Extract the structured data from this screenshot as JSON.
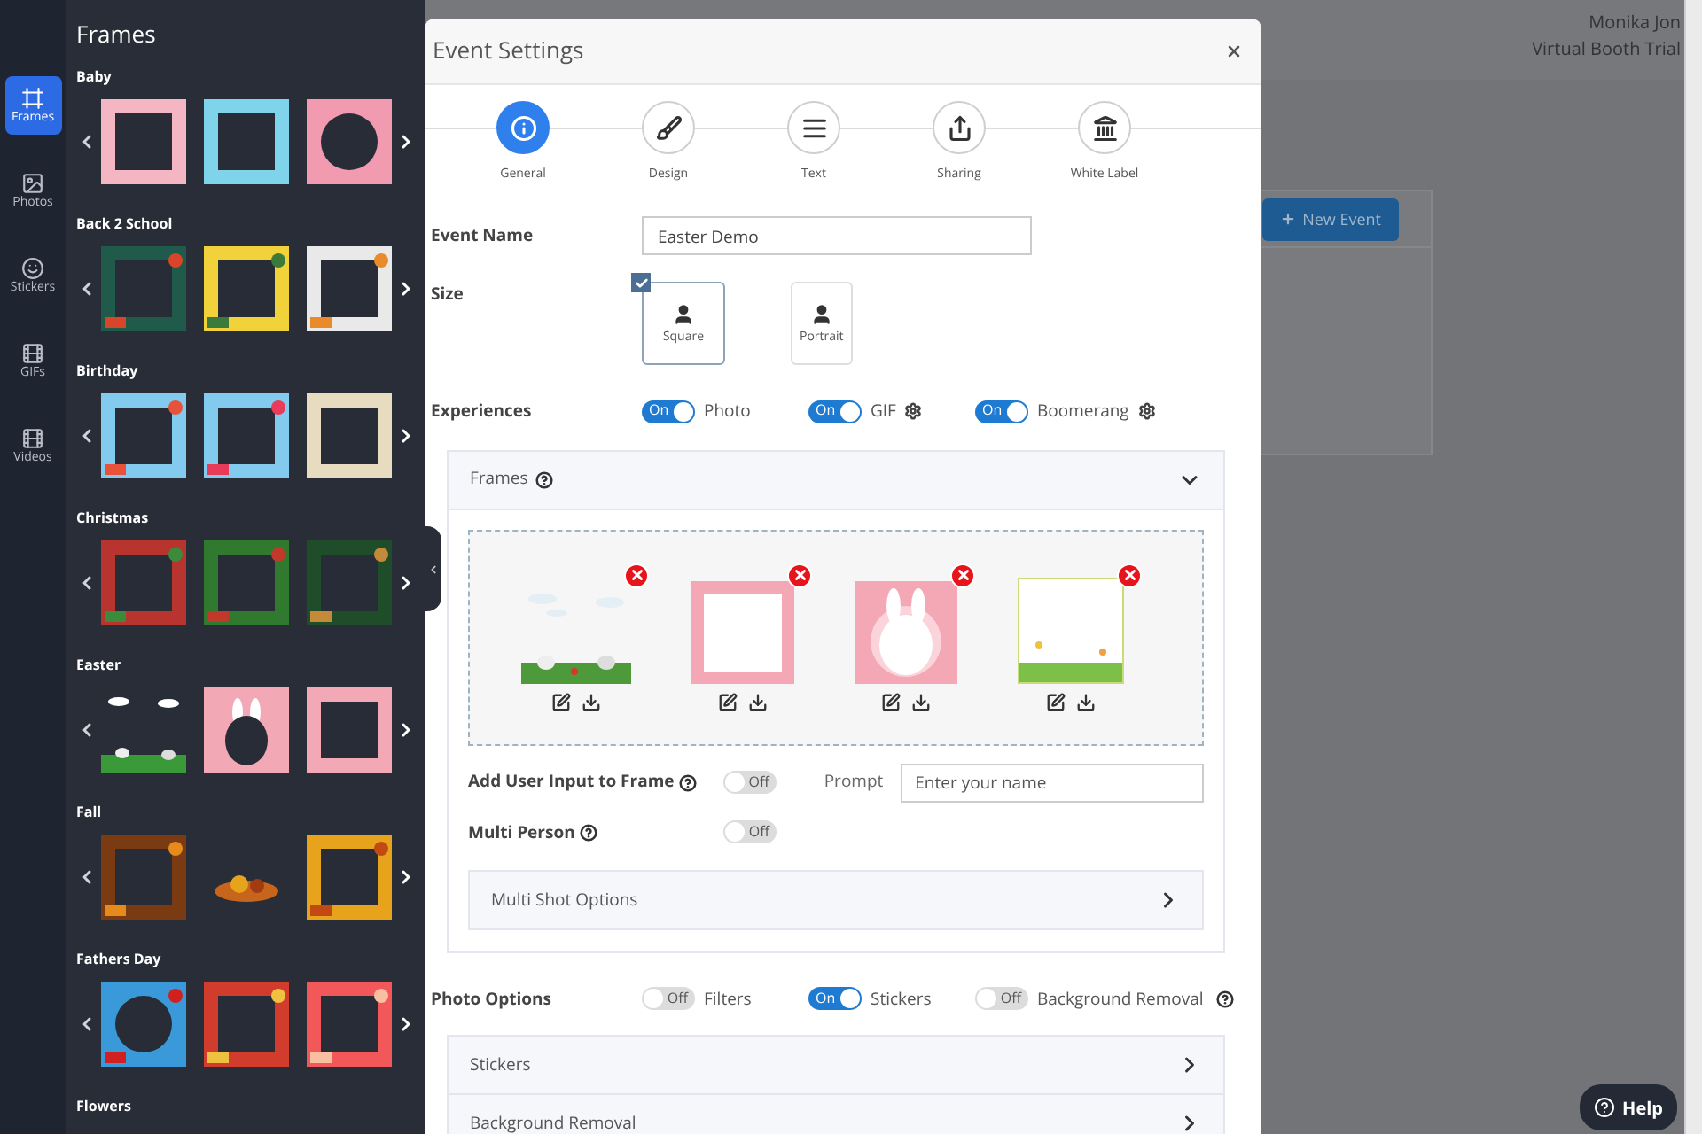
{
  "sidebar": {
    "items": [
      {
        "label": "Frames",
        "selected": true
      },
      {
        "label": "Photos",
        "selected": false
      },
      {
        "label": "Stickers",
        "selected": false
      },
      {
        "label": "GIFs",
        "selected": false
      },
      {
        "label": "Videos",
        "selected": false
      }
    ]
  },
  "frames_panel": {
    "title": "Frames",
    "categories": [
      {
        "name": "Baby"
      },
      {
        "name": "Back 2 School"
      },
      {
        "name": "Birthday"
      },
      {
        "name": "Christmas"
      },
      {
        "name": "Easter"
      },
      {
        "name": "Fall"
      },
      {
        "name": "Fathers Day"
      },
      {
        "name": "Flowers"
      }
    ]
  },
  "page": {
    "user_name": "Monika Jon",
    "account": "Virtual Booth Trial",
    "new_event_button": "New Event"
  },
  "modal": {
    "title": "Event Settings",
    "steps": [
      {
        "label": "General",
        "selected": true
      },
      {
        "label": "Design",
        "selected": false
      },
      {
        "label": "Text",
        "selected": false
      },
      {
        "label": "Sharing",
        "selected": false
      },
      {
        "label": "White Label",
        "selected": false
      }
    ],
    "event_name": {
      "label": "Event Name",
      "value": "Easter Demo"
    },
    "size": {
      "label": "Size",
      "options": [
        {
          "label": "Square",
          "selected": true
        },
        {
          "label": "Portrait",
          "selected": false
        }
      ]
    },
    "experiences": {
      "label": "Experiences",
      "items": [
        {
          "label": "Photo",
          "on": true,
          "switch_text": "On",
          "settings": false
        },
        {
          "label": "GIF",
          "on": true,
          "switch_text": "On",
          "settings": true
        },
        {
          "label": "Boomerang",
          "on": true,
          "switch_text": "On",
          "settings": true
        }
      ]
    },
    "frames": {
      "title": "Frames",
      "expanded": true,
      "user_input": {
        "label": "Add User Input to Frame",
        "on": false,
        "switch_text": "Off",
        "prompt_label": "Prompt",
        "prompt_placeholder": "Enter your name"
      },
      "multi_person": {
        "label": "Multi Person",
        "on": false,
        "switch_text": "Off"
      },
      "multi_shot": {
        "title": "Multi Shot Options",
        "expanded": false
      }
    },
    "photo_options": {
      "label": "Photo Options",
      "items": [
        {
          "label": "Filters",
          "on": false,
          "switch_text": "Off",
          "help": false
        },
        {
          "label": "Stickers",
          "on": true,
          "switch_text": "On",
          "help": false
        },
        {
          "label": "Background Removal",
          "on": false,
          "switch_text": "Off",
          "help": true
        }
      ]
    },
    "sections": [
      {
        "title": "Stickers",
        "expanded": false
      },
      {
        "title": "Background Removal",
        "expanded": false
      }
    ]
  },
  "help_button": "Help"
}
